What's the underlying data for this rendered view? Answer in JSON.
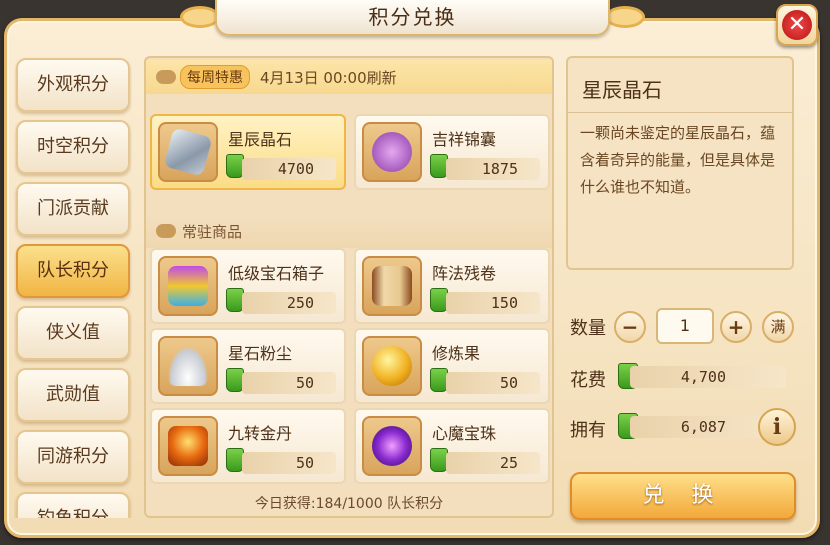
{
  "window": {
    "title": "积分兑换"
  },
  "tabs": [
    "外观积分",
    "时空积分",
    "门派贡献",
    "队长积分",
    "侠义值",
    "武勋值",
    "同游积分",
    "钓鱼积分"
  ],
  "active_tab": "队长积分",
  "weekly": {
    "badge": "每周特惠",
    "refresh": "4月13日 00:00刷新",
    "items": [
      {
        "name": "星辰晶石",
        "price": "4700",
        "icon": "crystal-icon"
      },
      {
        "name": "吉祥锦囊",
        "price": "1875",
        "icon": "pouch-icon"
      }
    ]
  },
  "regular": {
    "label": "常驻商品",
    "items": [
      {
        "name": "低级宝石箱子",
        "price": "250",
        "icon": "gem-box-icon"
      },
      {
        "name": "阵法残卷",
        "price": "150",
        "icon": "scroll-icon"
      },
      {
        "name": "星石粉尘",
        "price": "50",
        "icon": "dust-icon"
      },
      {
        "name": "修炼果",
        "price": "50",
        "icon": "fruit-icon"
      },
      {
        "name": "九转金丹",
        "price": "50",
        "icon": "elixir-icon"
      },
      {
        "name": "心魔宝珠",
        "price": "25",
        "icon": "orb-icon"
      }
    ]
  },
  "footer": "今日获得:184/1000 队长积分",
  "detail": {
    "name": "星辰晶石",
    "description": "一颗尚未鉴定的星辰晶石，蕴含着奇异的能量，但是具体是什么谁也不知道。"
  },
  "quantity": {
    "label": "数量",
    "value": "1",
    "max_label": "满"
  },
  "cost": {
    "label": "花费",
    "value": "4,700"
  },
  "own": {
    "label": "拥有",
    "value": "6,087"
  },
  "exchange_label": "兑 换"
}
